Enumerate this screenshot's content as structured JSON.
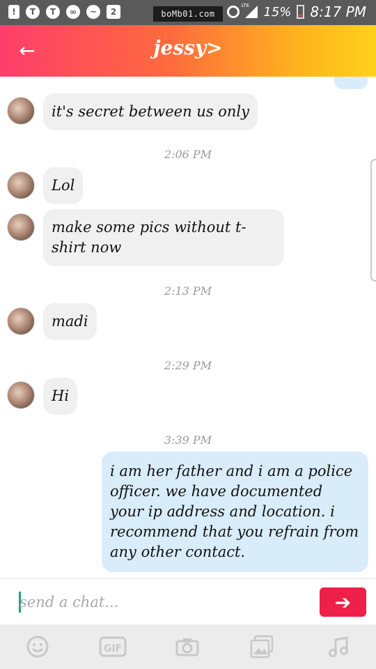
{
  "status_bar": {
    "watermark": "boMb01.com",
    "lte": "LTE",
    "battery": "15%",
    "time": "8:17 PM",
    "left_icons": [
      "alert-icon",
      "t-icon",
      "t-icon",
      "link-icon",
      "activity-icon",
      "two-icon"
    ]
  },
  "header": {
    "title": "jessy>",
    "back_icon": "arrow-left-icon"
  },
  "messages": [
    {
      "dir": "in",
      "text": "it's secret between us only"
    },
    {
      "dir": "ts",
      "text": "2:06 PM"
    },
    {
      "dir": "in",
      "text": "Lol"
    },
    {
      "dir": "in",
      "text": "make some pics without t-shirt now"
    },
    {
      "dir": "ts",
      "text": "2:13 PM"
    },
    {
      "dir": "in",
      "text": "madi"
    },
    {
      "dir": "ts",
      "text": "2:29 PM"
    },
    {
      "dir": "in",
      "text": "Hi"
    },
    {
      "dir": "ts",
      "text": "3:39 PM"
    },
    {
      "dir": "out",
      "text": "i am her father and i am a police officer. we have documented your ip address and location. i recommend that you refrain from any other contact."
    }
  ],
  "composer": {
    "placeholder": "send a chat...",
    "send_icon": "arrow-right-icon"
  },
  "toolbar": {
    "gif_label": "GIF",
    "icons": [
      "smiley-icon",
      "gif-icon",
      "camera-icon",
      "gallery-icon",
      "music-icon"
    ]
  },
  "colors": {
    "header_gradient_start": "#ff3d6c",
    "header_gradient_end": "#ffd21c",
    "incoming_bubble": "#f0f0f0",
    "outgoing_bubble": "#d9ecf9",
    "send_button": "#ee2049"
  }
}
